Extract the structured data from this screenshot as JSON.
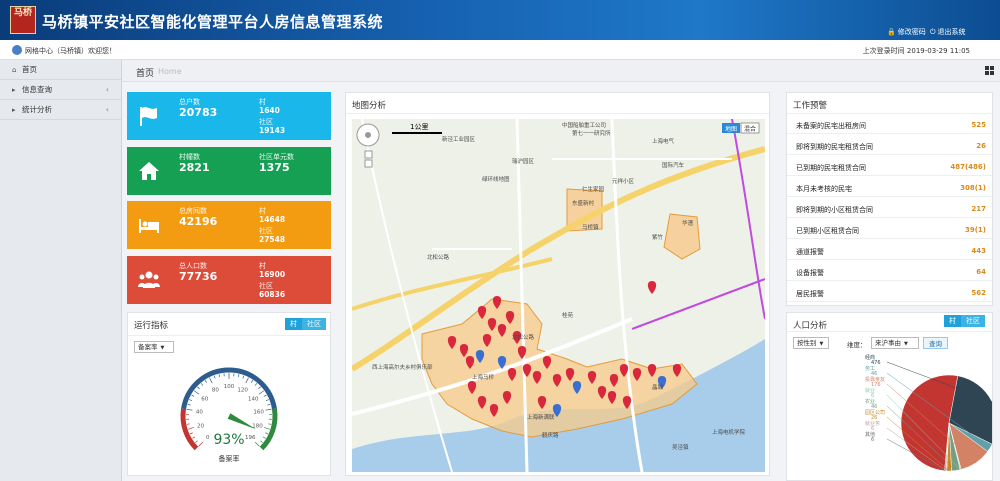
{
  "header": {
    "logo_text": "马桥",
    "title": "马桥镇平安社区智能化管理平台人房信息管理系统",
    "change_password": "修改密码",
    "logout": "退出系统"
  },
  "user": {
    "welcome": "网格中心（马桥镇）欢迎您！",
    "last_login": "上次登录时间 2019-03-29 11:05"
  },
  "sidebar": {
    "items": [
      {
        "label": "首页",
        "icon": "home-icon"
      },
      {
        "label": "信息查询",
        "icon": "caret-right-icon"
      },
      {
        "label": "统计分析",
        "icon": "caret-right-icon"
      }
    ]
  },
  "breadcrumb": {
    "main": "首页",
    "sub": "Home"
  },
  "stats": [
    {
      "title": "总户数",
      "value": "20783",
      "sub1_label": "村",
      "sub1_value": "1640",
      "sub2_label": "社区",
      "sub2_value": "19143",
      "color": "#1ab7ea",
      "icon": "flag-icon"
    },
    {
      "title": "村幢数",
      "value": "2821",
      "sub1_label": "社区单元数",
      "sub1_value": "1375",
      "color": "#16a053",
      "icon": "house-icon"
    },
    {
      "title": "总房间数",
      "value": "42196",
      "sub1_label": "村",
      "sub1_value": "14648",
      "sub2_label": "社区",
      "sub2_value": "27548",
      "color": "#f39c12",
      "icon": "bed-icon"
    },
    {
      "title": "总人口数",
      "value": "77736",
      "sub1_label": "村",
      "sub1_value": "16900",
      "sub2_label": "社区",
      "sub2_value": "60836",
      "color": "#dd4b39",
      "icon": "people-icon"
    }
  ],
  "run": {
    "title": "运行指标",
    "toggle": [
      "村",
      "社区"
    ],
    "select": "备案率",
    "gauge_value": "93%",
    "gauge_label": "备案率",
    "gauge_fraction": 0.93,
    "gauge_ticks": [
      "0",
      "20",
      "40",
      "60",
      "80",
      "100",
      "120",
      "140",
      "160",
      "180",
      "196"
    ]
  },
  "map": {
    "title": "地图分析",
    "scale": "1公里",
    "layer_buttons": [
      "地图",
      "混合"
    ],
    "labels": [
      "中国船舶重工公司",
      "第七一一研究所",
      "新泾工业园区",
      "瑞沪园区",
      "上海电气",
      "国际汽车",
      "仁生家园",
      "东盛新村",
      "华漕",
      "紫竹",
      "元祥小区",
      "绿环线地图",
      "马桥镇",
      "北松公路",
      "桂苑",
      "北松公路",
      "上海马桥",
      "晶城",
      "西上海高尔夫乡村俱乐部",
      "上海新满联",
      "鹤庆路",
      "上海电机学院",
      "吴泾镇"
    ]
  },
  "warnings": {
    "title": "工作预警",
    "items": [
      {
        "label": "未备案的民宅出租房间",
        "value": "525"
      },
      {
        "label": "即将到期的民宅租赁合同",
        "value": "26"
      },
      {
        "label": "已到期的民宅租赁合同",
        "value": "487(486)"
      },
      {
        "label": "本月未考核的民宅",
        "value": "308(1)"
      },
      {
        "label": "即将到期的小区租赁合同",
        "value": "217"
      },
      {
        "label": "已到期小区租赁合同",
        "value": "39(1)"
      },
      {
        "label": "通道报警",
        "value": "443"
      },
      {
        "label": "设备报警",
        "value": "64"
      },
      {
        "label": "居民报警",
        "value": "562"
      }
    ]
  },
  "population": {
    "title": "人口分析",
    "toggle": [
      "村",
      "社区"
    ],
    "select1": "按性别",
    "select2_label": "维度：",
    "select2": "来沪事由",
    "query": "查询",
    "chart_data": {
      "type": "pie",
      "categories": [
        "探亲访友",
        "经商",
        "务工",
        "投靠亲友",
        "就业",
        "农业",
        "园区公司",
        "就业务",
        "其他"
      ],
      "values": [
        836,
        476,
        46,
        176,
        6,
        46,
        26,
        6,
        6
      ],
      "colors": [
        "#c23531",
        "#2f4554",
        "#61a0a8",
        "#d48265",
        "#91c7ae",
        "#749f83",
        "#ca8622",
        "#bda29a",
        "#6e7074"
      ]
    }
  }
}
